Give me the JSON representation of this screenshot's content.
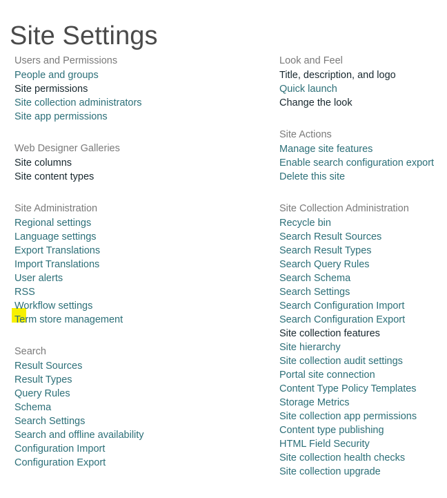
{
  "page": {
    "title": "Site Settings",
    "accent_link_color": "#2c6f78",
    "visited_link_color": "#17272e",
    "heading_color": "#7a7a7a",
    "title_color": "#4a4a4a",
    "highlight_color": "#f7f000",
    "background_color": "#ffffff"
  },
  "highlight": {
    "target_label": "Workflow settings",
    "note": "yellow marker over start of Workflow settings link"
  },
  "left_column": {
    "sections": [
      {
        "heading": "Users and Permissions",
        "links": [
          {
            "label": "People and groups",
            "visited": false
          },
          {
            "label": "Site permissions",
            "visited": true
          },
          {
            "label": "Site collection administrators",
            "visited": false
          },
          {
            "label": "Site app permissions",
            "visited": false
          }
        ]
      },
      {
        "heading": "Web Designer Galleries",
        "links": [
          {
            "label": "Site columns",
            "visited": true
          },
          {
            "label": "Site content types",
            "visited": true
          }
        ]
      },
      {
        "heading": "Site Administration",
        "links": [
          {
            "label": "Regional settings",
            "visited": false
          },
          {
            "label": "Language settings",
            "visited": false
          },
          {
            "label": "Export Translations",
            "visited": false
          },
          {
            "label": "Import Translations",
            "visited": false
          },
          {
            "label": "User alerts",
            "visited": false
          },
          {
            "label": "RSS",
            "visited": false
          },
          {
            "label": "Workflow settings",
            "visited": false
          },
          {
            "label": "Term store management",
            "visited": false
          }
        ]
      },
      {
        "heading": "Search",
        "links": [
          {
            "label": "Result Sources",
            "visited": false
          },
          {
            "label": "Result Types",
            "visited": false
          },
          {
            "label": "Query Rules",
            "visited": false
          },
          {
            "label": "Schema",
            "visited": false
          },
          {
            "label": "Search Settings",
            "visited": false
          },
          {
            "label": "Search and offline availability",
            "visited": false
          },
          {
            "label": "Configuration Import",
            "visited": false
          },
          {
            "label": "Configuration Export",
            "visited": false
          }
        ]
      }
    ]
  },
  "right_column": {
    "sections": [
      {
        "heading": "Look and Feel",
        "links": [
          {
            "label": "Title, description, and logo",
            "visited": true
          },
          {
            "label": "Quick launch",
            "visited": false
          },
          {
            "label": "Change the look",
            "visited": true
          }
        ]
      },
      {
        "heading": "Site Actions",
        "links": [
          {
            "label": "Manage site features",
            "visited": false
          },
          {
            "label": "Enable search configuration export",
            "visited": false
          },
          {
            "label": "Delete this site",
            "visited": false
          }
        ]
      },
      {
        "heading": "Site Collection Administration",
        "links": [
          {
            "label": "Recycle bin",
            "visited": false
          },
          {
            "label": "Search Result Sources",
            "visited": false
          },
          {
            "label": "Search Result Types",
            "visited": false
          },
          {
            "label": "Search Query Rules",
            "visited": false
          },
          {
            "label": "Search Schema",
            "visited": false
          },
          {
            "label": "Search Settings",
            "visited": false
          },
          {
            "label": "Search Configuration Import",
            "visited": false
          },
          {
            "label": "Search Configuration Export",
            "visited": false
          },
          {
            "label": "Site collection features",
            "visited": true
          },
          {
            "label": "Site hierarchy",
            "visited": false
          },
          {
            "label": "Site collection audit settings",
            "visited": false
          },
          {
            "label": "Portal site connection",
            "visited": false
          },
          {
            "label": "Content Type Policy Templates",
            "visited": false
          },
          {
            "label": "Storage Metrics",
            "visited": false
          },
          {
            "label": "Site collection app permissions",
            "visited": false
          },
          {
            "label": "Content type publishing",
            "visited": false
          },
          {
            "label": "HTML Field Security",
            "visited": false
          },
          {
            "label": "Site collection health checks",
            "visited": false
          },
          {
            "label": "Site collection upgrade",
            "visited": false
          }
        ]
      }
    ]
  }
}
